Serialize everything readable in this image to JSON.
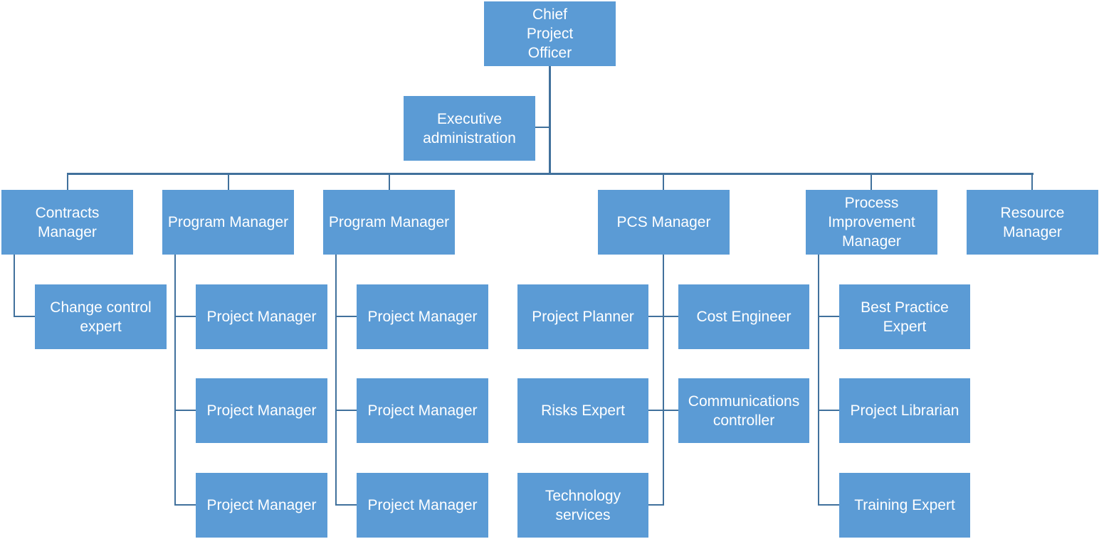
{
  "diagram": {
    "type": "org-chart",
    "colors": {
      "box_fill": "#5b9bd5",
      "box_text": "#ffffff",
      "connector": "#41719c"
    },
    "root": {
      "label": "Chief Project Officer"
    },
    "assistant": {
      "label": "Executive administration"
    },
    "managers": [
      {
        "label": "Contracts Manager",
        "reports": [
          "Change control expert"
        ]
      },
      {
        "label": "Program Manager",
        "reports": [
          "Project Manager",
          "Project Manager",
          "Project Manager"
        ]
      },
      {
        "label": "Program Manager",
        "reports": [
          "Project Manager",
          "Project Manager",
          "Project Manager"
        ]
      },
      {
        "label": "PCS Manager",
        "reports": [
          "Project Planner",
          "Cost Engineer",
          "Risks Expert",
          "Communications controller",
          "Technology services"
        ]
      },
      {
        "label": "Process Improvement Manager",
        "reports": [
          "Best Practice Expert",
          "Project Librarian",
          "Training Expert"
        ]
      },
      {
        "label": "Resource Manager",
        "reports": []
      }
    ]
  }
}
